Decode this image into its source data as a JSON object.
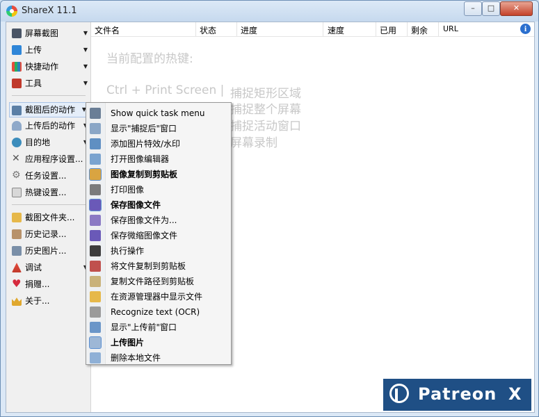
{
  "window": {
    "title": "ShareX 11.1",
    "min": "–",
    "max": "□",
    "close": "✕"
  },
  "sidebar": {
    "capture": "屏幕截图",
    "upload": "上传",
    "workflows": "快捷动作",
    "tools": "工具",
    "after_capture": "截图后的动作",
    "after_upload": "上传后的动作",
    "destinations": "目的地",
    "app_settings": "应用程序设置...",
    "task_settings": "任务设置...",
    "hotkey_settings": "热键设置...",
    "screenshots_folder": "截图文件夹...",
    "history": "历史记录...",
    "image_history": "历史图片...",
    "debug": "调试",
    "donate": "捐赠...",
    "about": "关于..."
  },
  "columns": [
    "文件名",
    "状态",
    "进度",
    "速度",
    "已用",
    "剩余",
    "URL"
  ],
  "hotkeys": {
    "title": "当前配置的热键:",
    "rows": [
      {
        "key": "Ctrl + Print Screen  |",
        "action": "捕捉矩形区域"
      },
      {
        "key": "",
        "action": "捕捉整个屏幕"
      },
      {
        "key": "",
        "action": "捕捉活动窗口"
      },
      {
        "key": "",
        "action": "屏幕录制"
      }
    ]
  },
  "after_capture_menu": [
    {
      "label": "Show quick task menu",
      "icon": "menu-icon",
      "checked": false
    },
    {
      "label": "显示\"捕捉后\"窗口",
      "icon": "window-icon",
      "checked": false
    },
    {
      "label": "添加图片特效/水印",
      "icon": "image-effects-icon",
      "checked": false
    },
    {
      "label": "打开图像编辑器",
      "icon": "image-editor-icon",
      "checked": false
    },
    {
      "label": "图像复制到剪贴板",
      "icon": "clipboard-icon",
      "checked": true
    },
    {
      "label": "打印图像",
      "icon": "printer-icon",
      "checked": false
    },
    {
      "label": "保存图像文件",
      "icon": "save-icon",
      "checked": true
    },
    {
      "label": "保存图像文件为...",
      "icon": "save-as-icon",
      "checked": false
    },
    {
      "label": "保存微缩图像文件",
      "icon": "save-thumbnail-icon",
      "checked": false
    },
    {
      "label": "执行操作",
      "icon": "terminal-icon",
      "checked": false
    },
    {
      "label": "将文件复制到剪贴板",
      "icon": "copy-file-icon",
      "checked": false
    },
    {
      "label": "复制文件路径到剪贴板",
      "icon": "copy-path-icon",
      "checked": false
    },
    {
      "label": "在资源管理器中显示文件",
      "icon": "folder-icon",
      "checked": false
    },
    {
      "label": "Recognize text (OCR)",
      "icon": "ocr-icon",
      "checked": false
    },
    {
      "label": "显示\"上传前\"窗口",
      "icon": "window-arrow-icon",
      "checked": false
    },
    {
      "label": "上传图片",
      "icon": "cloud-upload-icon",
      "checked": true
    },
    {
      "label": "删除本地文件",
      "icon": "delete-file-icon",
      "checked": false
    }
  ],
  "banner": {
    "text": "Patreon",
    "mark": "X"
  },
  "colors": {
    "accent": "#1f4f85",
    "hotkey_text": "#c8c8c8",
    "menu_bg": "#f5f5f5"
  }
}
